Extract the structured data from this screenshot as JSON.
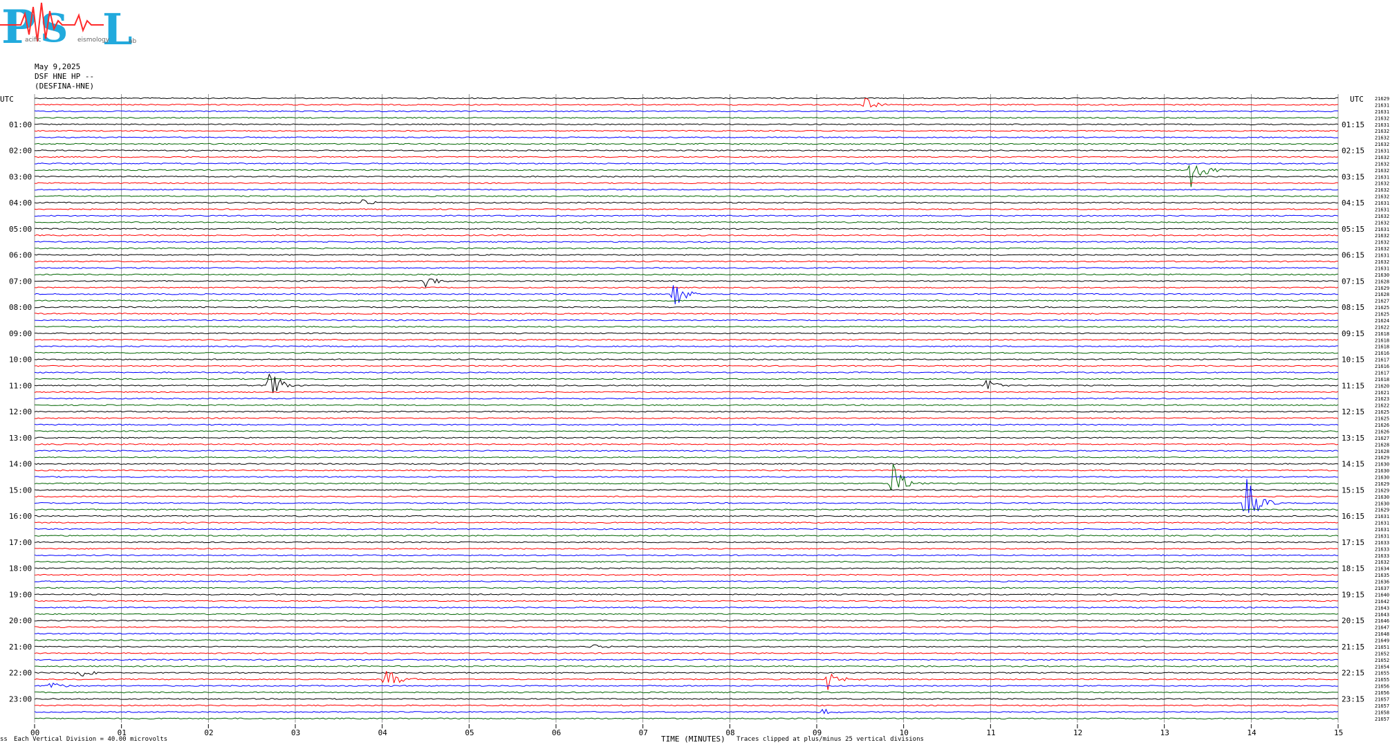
{
  "header": {
    "logo_text": "PSL",
    "logo_sub": "Pacific Seismology Lab",
    "date": "May 9,2025",
    "station": "DSF HNE HP --",
    "station_name": "(DESFINA-HNE)"
  },
  "footer": {
    "vertical_division": "Each Vertical Division =    40.00 microvolts",
    "clip_note": "Traces clipped at plus/minus 25 vertical divisions",
    "corner_mark": "ss"
  },
  "colors": {
    "black": "#000000",
    "red": "#ff0000",
    "blue": "#0000ff",
    "green": "#006400",
    "grid": "#7a7a7a"
  },
  "chart_data": {
    "type": "line",
    "title": "",
    "xlabel": "TIME (MINUTES)",
    "ylabel": "UTC",
    "xlim": [
      0,
      15
    ],
    "x_ticks": [
      "00",
      "01",
      "02",
      "03",
      "04",
      "05",
      "06",
      "07",
      "08",
      "09",
      "10",
      "11",
      "12",
      "13",
      "14",
      "15"
    ],
    "left_row_labels": [
      "01:00",
      "02:00",
      "03:00",
      "04:00",
      "05:00",
      "06:00",
      "07:00",
      "08:00",
      "09:00",
      "10:00",
      "11:00",
      "12:00",
      "13:00",
      "14:00",
      "15:00",
      "16:00",
      "17:00",
      "18:00",
      "19:00",
      "20:00",
      "21:00",
      "22:00",
      "23:00"
    ],
    "right_row_labels": [
      "01:15",
      "02:15",
      "03:15",
      "04:15",
      "05:15",
      "06:15",
      "07:15",
      "08:15",
      "09:15",
      "10:15",
      "11:15",
      "12:15",
      "13:15",
      "14:15",
      "15:15",
      "16:15",
      "17:15",
      "18:15",
      "19:15",
      "20:15",
      "21:15",
      "22:15",
      "23:15"
    ],
    "trace_colors_cycle": [
      "black",
      "red",
      "blue",
      "green"
    ],
    "trace_count": 96,
    "trace_offsets": [
      21629,
      21631,
      21631,
      21632,
      21631,
      21632,
      21632,
      21632,
      21631,
      21632,
      21632,
      21632,
      21631,
      21632,
      21632,
      21632,
      21631,
      21631,
      21632,
      21632,
      21631,
      21632,
      21632,
      21632,
      21631,
      21632,
      21631,
      21630,
      21628,
      21629,
      21628,
      21627,
      21625,
      21625,
      21624,
      21622,
      21618,
      21618,
      21618,
      21616,
      21617,
      21616,
      21617,
      21618,
      21620,
      21621,
      21623,
      21622,
      21625,
      21625,
      21626,
      21626,
      21627,
      21628,
      21628,
      21629,
      21630,
      21630,
      21630,
      21629,
      21629,
      21630,
      21630,
      21629,
      21631,
      21631,
      21631,
      21631,
      21633,
      21633,
      21633,
      21632,
      21634,
      21635,
      21636,
      21637,
      21640,
      21642,
      21643,
      21643,
      21646,
      21647,
      21648,
      21649,
      21651,
      21652,
      21652,
      21654,
      21655,
      21655,
      21656,
      21656,
      21657,
      21657,
      21658,
      21657
    ],
    "events": [
      {
        "trace": 1,
        "minute": 9.55,
        "amplitude": 12
      },
      {
        "trace": 11,
        "minute": 13.3,
        "amplitude": 30
      },
      {
        "trace": 16,
        "minute": 3.5,
        "amplitude": 4
      },
      {
        "trace": 16,
        "minute": 3.75,
        "amplitude": 5
      },
      {
        "trace": 28,
        "minute": 4.5,
        "amplitude": 10
      },
      {
        "trace": 30,
        "minute": 7.35,
        "amplitude": 28
      },
      {
        "trace": 44,
        "minute": 2.7,
        "amplitude": 26
      },
      {
        "trace": 44,
        "minute": 10.95,
        "amplitude": 14
      },
      {
        "trace": 59,
        "minute": 9.85,
        "amplitude": 38
      },
      {
        "trace": 62,
        "minute": 13.92,
        "amplitude": 48
      },
      {
        "trace": 84,
        "minute": 6.4,
        "amplitude": 7
      },
      {
        "trace": 88,
        "minute": 0.5,
        "amplitude": 10
      },
      {
        "trace": 89,
        "minute": 4.02,
        "amplitude": 24
      },
      {
        "trace": 89,
        "minute": 9.12,
        "amplitude": 18
      },
      {
        "trace": 90,
        "minute": 0.15,
        "amplitude": 8
      },
      {
        "trace": 94,
        "minute": 9.05,
        "amplitude": 6
      }
    ]
  }
}
